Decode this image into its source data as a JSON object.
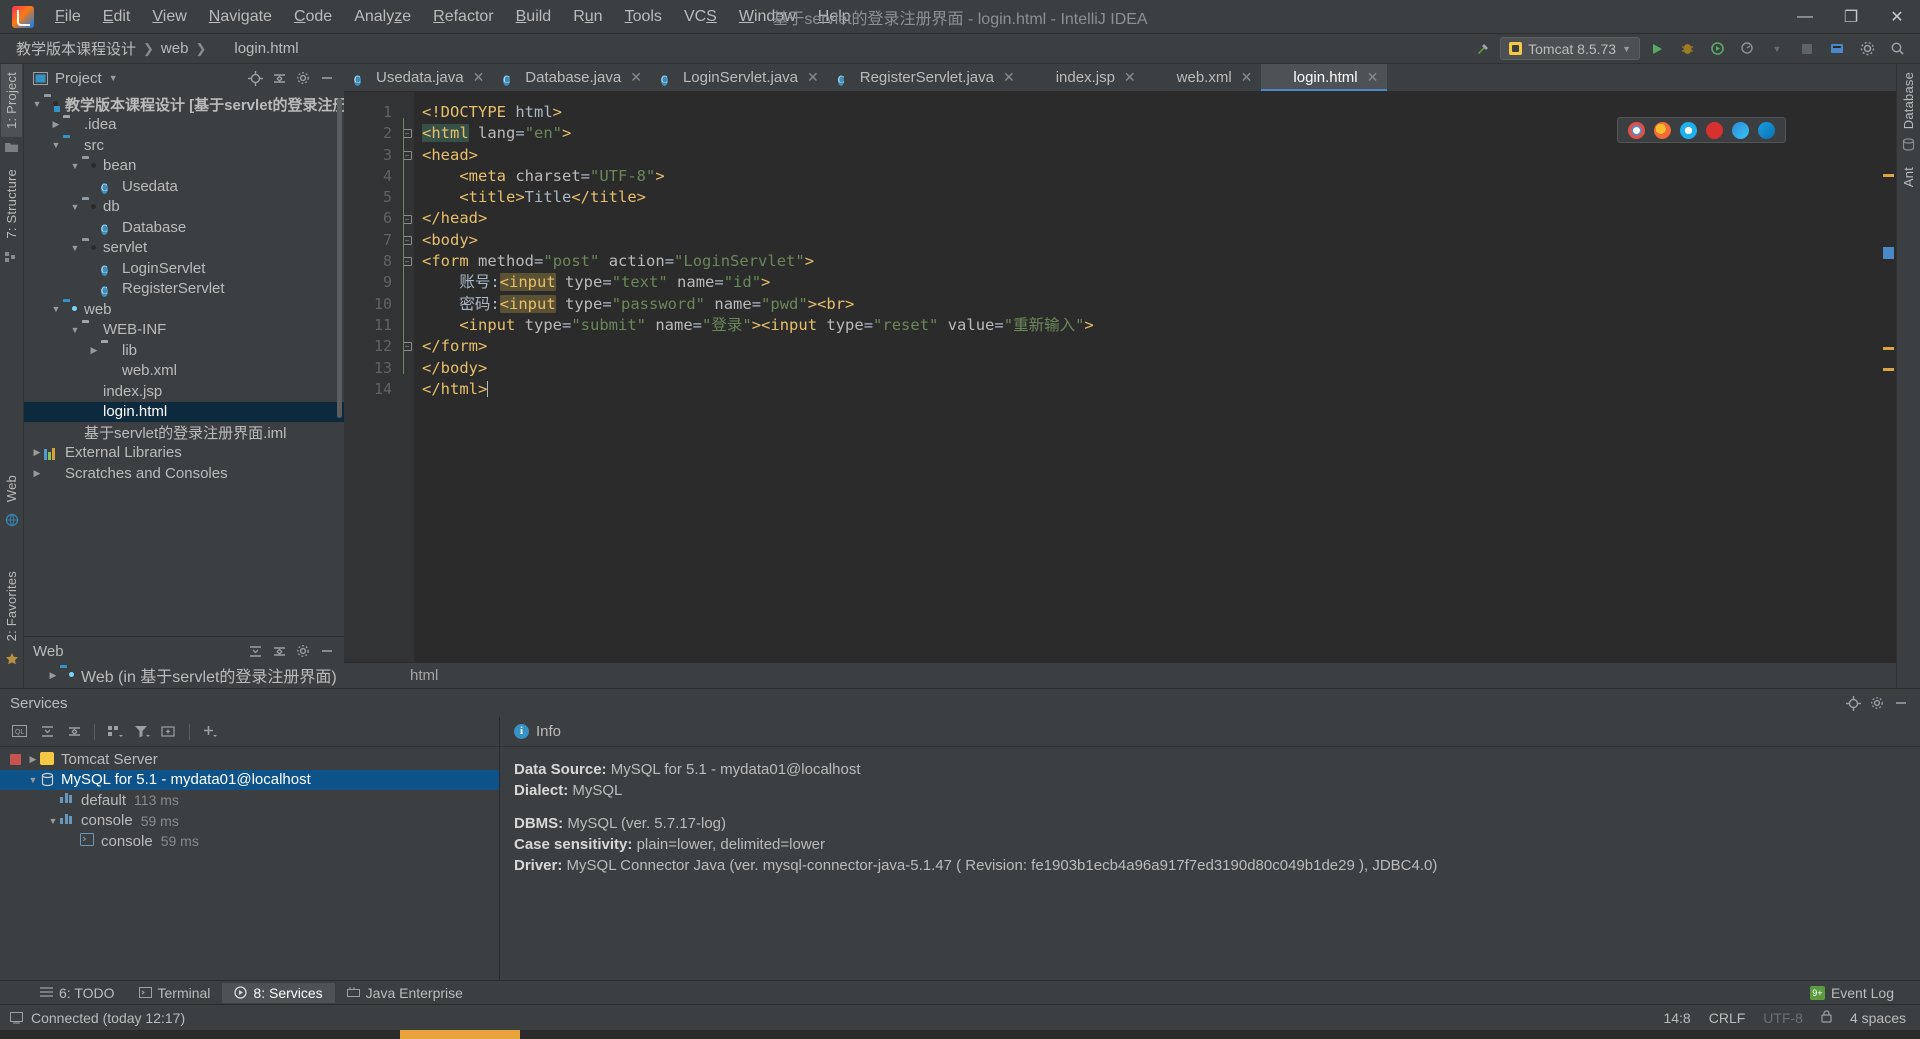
{
  "window": {
    "title": "基于servlet的登录注册界面 - login.html - IntelliJ IDEA",
    "minimize": "—",
    "maximize": "❐",
    "close": "✕"
  },
  "menu": [
    {
      "label": "File"
    },
    {
      "label": "Edit"
    },
    {
      "label": "View"
    },
    {
      "label": "Navigate"
    },
    {
      "label": "Code"
    },
    {
      "label": "Analyze"
    },
    {
      "label": "Refactor"
    },
    {
      "label": "Build"
    },
    {
      "label": "Run"
    },
    {
      "label": "Tools"
    },
    {
      "label": "VCS"
    },
    {
      "label": "Window"
    },
    {
      "label": "Help"
    }
  ],
  "breadcrumbs": [
    {
      "label": "教学版本课程设计"
    },
    {
      "label": "web"
    },
    {
      "label": "login.html"
    }
  ],
  "toolbar": {
    "run_config": "Tomcat 8.5.73",
    "run_label": "▶",
    "debug_label": "🐞",
    "stop_label": "■"
  },
  "left_strip": [
    {
      "label": "1: Project",
      "active": true
    },
    {
      "label": "7: Structure",
      "active": false
    },
    {
      "label": "Web",
      "active": false
    },
    {
      "label": "2: Favorites",
      "active": false
    }
  ],
  "right_strip": [
    {
      "label": "Database"
    },
    {
      "label": "Ant"
    }
  ],
  "project_panel": {
    "title": "Project",
    "tree": [
      {
        "label": "教学版本课程设计 [基于servlet的登录注册界面]",
        "indent": 0,
        "arrow": "▼",
        "icon": "module-folder",
        "bold": true,
        "selected": false
      },
      {
        "label": ".idea",
        "indent": 1,
        "arrow": "▶",
        "icon": "folder",
        "bold": false,
        "selected": false
      },
      {
        "label": "src",
        "indent": 1,
        "arrow": "▼",
        "icon": "source-folder",
        "bold": false,
        "selected": false
      },
      {
        "label": "bean",
        "indent": 2,
        "arrow": "▼",
        "icon": "package",
        "bold": false,
        "selected": false
      },
      {
        "label": "Usedata",
        "indent": 3,
        "arrow": "",
        "icon": "java-class",
        "bold": false,
        "selected": false
      },
      {
        "label": "db",
        "indent": 2,
        "arrow": "▼",
        "icon": "package",
        "bold": false,
        "selected": false
      },
      {
        "label": "Database",
        "indent": 3,
        "arrow": "",
        "icon": "java-class",
        "bold": false,
        "selected": false
      },
      {
        "label": "servlet",
        "indent": 2,
        "arrow": "▼",
        "icon": "package",
        "bold": false,
        "selected": false
      },
      {
        "label": "LoginServlet",
        "indent": 3,
        "arrow": "",
        "icon": "java-class",
        "bold": false,
        "selected": false
      },
      {
        "label": "RegisterServlet",
        "indent": 3,
        "arrow": "",
        "icon": "java-class",
        "bold": false,
        "selected": false
      },
      {
        "label": "web",
        "indent": 1,
        "arrow": "▼",
        "icon": "web-folder",
        "bold": false,
        "selected": false
      },
      {
        "label": "WEB-INF",
        "indent": 2,
        "arrow": "▼",
        "icon": "folder",
        "bold": false,
        "selected": false
      },
      {
        "label": "lib",
        "indent": 3,
        "arrow": "▶",
        "icon": "folder",
        "bold": false,
        "selected": false
      },
      {
        "label": "web.xml",
        "indent": 3,
        "arrow": "",
        "icon": "xml-file",
        "bold": false,
        "selected": false
      },
      {
        "label": "index.jsp",
        "indent": 2,
        "arrow": "",
        "icon": "jsp-file",
        "bold": false,
        "selected": false
      },
      {
        "label": "login.html",
        "indent": 2,
        "arrow": "",
        "icon": "html-file",
        "bold": false,
        "selected": true
      },
      {
        "label": "基于servlet的登录注册界面.iml",
        "indent": 1,
        "arrow": "",
        "icon": "iml-file",
        "bold": false,
        "selected": false
      },
      {
        "label": "External Libraries",
        "indent": 0,
        "arrow": "▶",
        "icon": "library",
        "bold": false,
        "selected": false
      },
      {
        "label": "Scratches and Consoles",
        "indent": 0,
        "arrow": "▶",
        "icon": "scratch",
        "bold": false,
        "selected": false
      }
    ]
  },
  "web_panel": {
    "title": "Web",
    "item": "Web (in 基于servlet的登录注册界面)"
  },
  "editor": {
    "tabs": [
      {
        "label": "Usedata.java",
        "icon": "java-class",
        "active": false
      },
      {
        "label": "Database.java",
        "icon": "java-class",
        "active": false
      },
      {
        "label": "LoginServlet.java",
        "icon": "java-class",
        "active": false
      },
      {
        "label": "RegisterServlet.java",
        "icon": "java-class",
        "active": false
      },
      {
        "label": "index.jsp",
        "icon": "jsp-file",
        "active": false
      },
      {
        "label": "web.xml",
        "icon": "xml-file",
        "active": false
      },
      {
        "label": "login.html",
        "icon": "html-file",
        "active": true
      }
    ],
    "close_glyph": "✕",
    "line_numbers": [
      "1",
      "2",
      "3",
      "4",
      "5",
      "6",
      "7",
      "8",
      "9",
      "10",
      "11",
      "12",
      "13",
      "14"
    ],
    "lines": [
      "<!DOCTYPE html>",
      "<html lang=\"en\">",
      "<head>",
      "    <meta charset=\"UTF-8\">",
      "    <title>Title</title>",
      "</head>",
      "<body>",
      "<form method=\"post\" action=\"LoginServlet\">",
      "    账号:<input type=\"text\" name=\"id\">",
      "    密码:<input type=\"password\" name=\"pwd\"><br>",
      "    <input type=\"submit\" name=\"登录\"><input type=\"reset\" value=\"重新输入\">",
      "</form>",
      "</body>",
      "</html>"
    ],
    "status_breadcrumb": "html"
  },
  "services": {
    "title": "Services",
    "tree": [
      {
        "label": "Tomcat Server",
        "time": "",
        "indent": 0,
        "arrow": "▶",
        "icon": "tomcat",
        "selected": false,
        "stopped": true
      },
      {
        "label": "MySQL for 5.1 - mydata01@localhost",
        "time": "",
        "indent": 1,
        "arrow": "▼",
        "icon": "database",
        "selected": true,
        "stopped": false
      },
      {
        "label": "default",
        "time": "113 ms",
        "indent": 2,
        "arrow": "",
        "icon": "node",
        "selected": false,
        "stopped": false
      },
      {
        "label": "console",
        "time": "59 ms",
        "indent": 2,
        "arrow": "▼",
        "icon": "node",
        "selected": false,
        "stopped": false
      },
      {
        "label": "console",
        "time": "59 ms",
        "indent": 3,
        "arrow": "",
        "icon": "console",
        "selected": false,
        "stopped": false
      }
    ],
    "info_tab": "Info",
    "info": [
      {
        "key": "Data Source:",
        "value": "MySQL for 5.1 - mydata01@localhost"
      },
      {
        "key": "Dialect:",
        "value": "MySQL"
      },
      {
        "key": "",
        "value": ""
      },
      {
        "key": "DBMS:",
        "value": "MySQL (ver. 5.7.17-log)"
      },
      {
        "key": "Case sensitivity:",
        "value": "plain=lower, delimited=lower"
      },
      {
        "key": "Driver:",
        "value": "MySQL Connector Java (ver. mysql-connector-java-5.1.47 ( Revision: fe1903b1ecb4a96a917f7ed3190d80c049b1de29 ), JDBC4.0)"
      }
    ]
  },
  "bottom_tabs": [
    {
      "label": "6: TODO",
      "active": false,
      "icon": "todo-icon"
    },
    {
      "label": "Terminal",
      "active": false,
      "icon": "terminal-icon"
    },
    {
      "label": "8: Services",
      "active": true,
      "icon": "services-icon"
    },
    {
      "label": "Java Enterprise",
      "active": false,
      "icon": "java-enterprise-icon"
    },
    {
      "label": "Event Log",
      "active": false,
      "icon": "event-log-icon"
    }
  ],
  "status_bar": {
    "message": "Connected (today 12:17)",
    "caret": "14:8",
    "line_separator": "CRLF",
    "encoding": "UTF-8",
    "indent": "4 spaces"
  },
  "colors": {
    "accent": "#4a88c7",
    "selection": "#0d293e",
    "services_selection": "#0d5288",
    "tag": "#e8bf6a",
    "string": "#6a8759",
    "background": "#3c3f41",
    "editor_background": "#2b2b2b"
  }
}
